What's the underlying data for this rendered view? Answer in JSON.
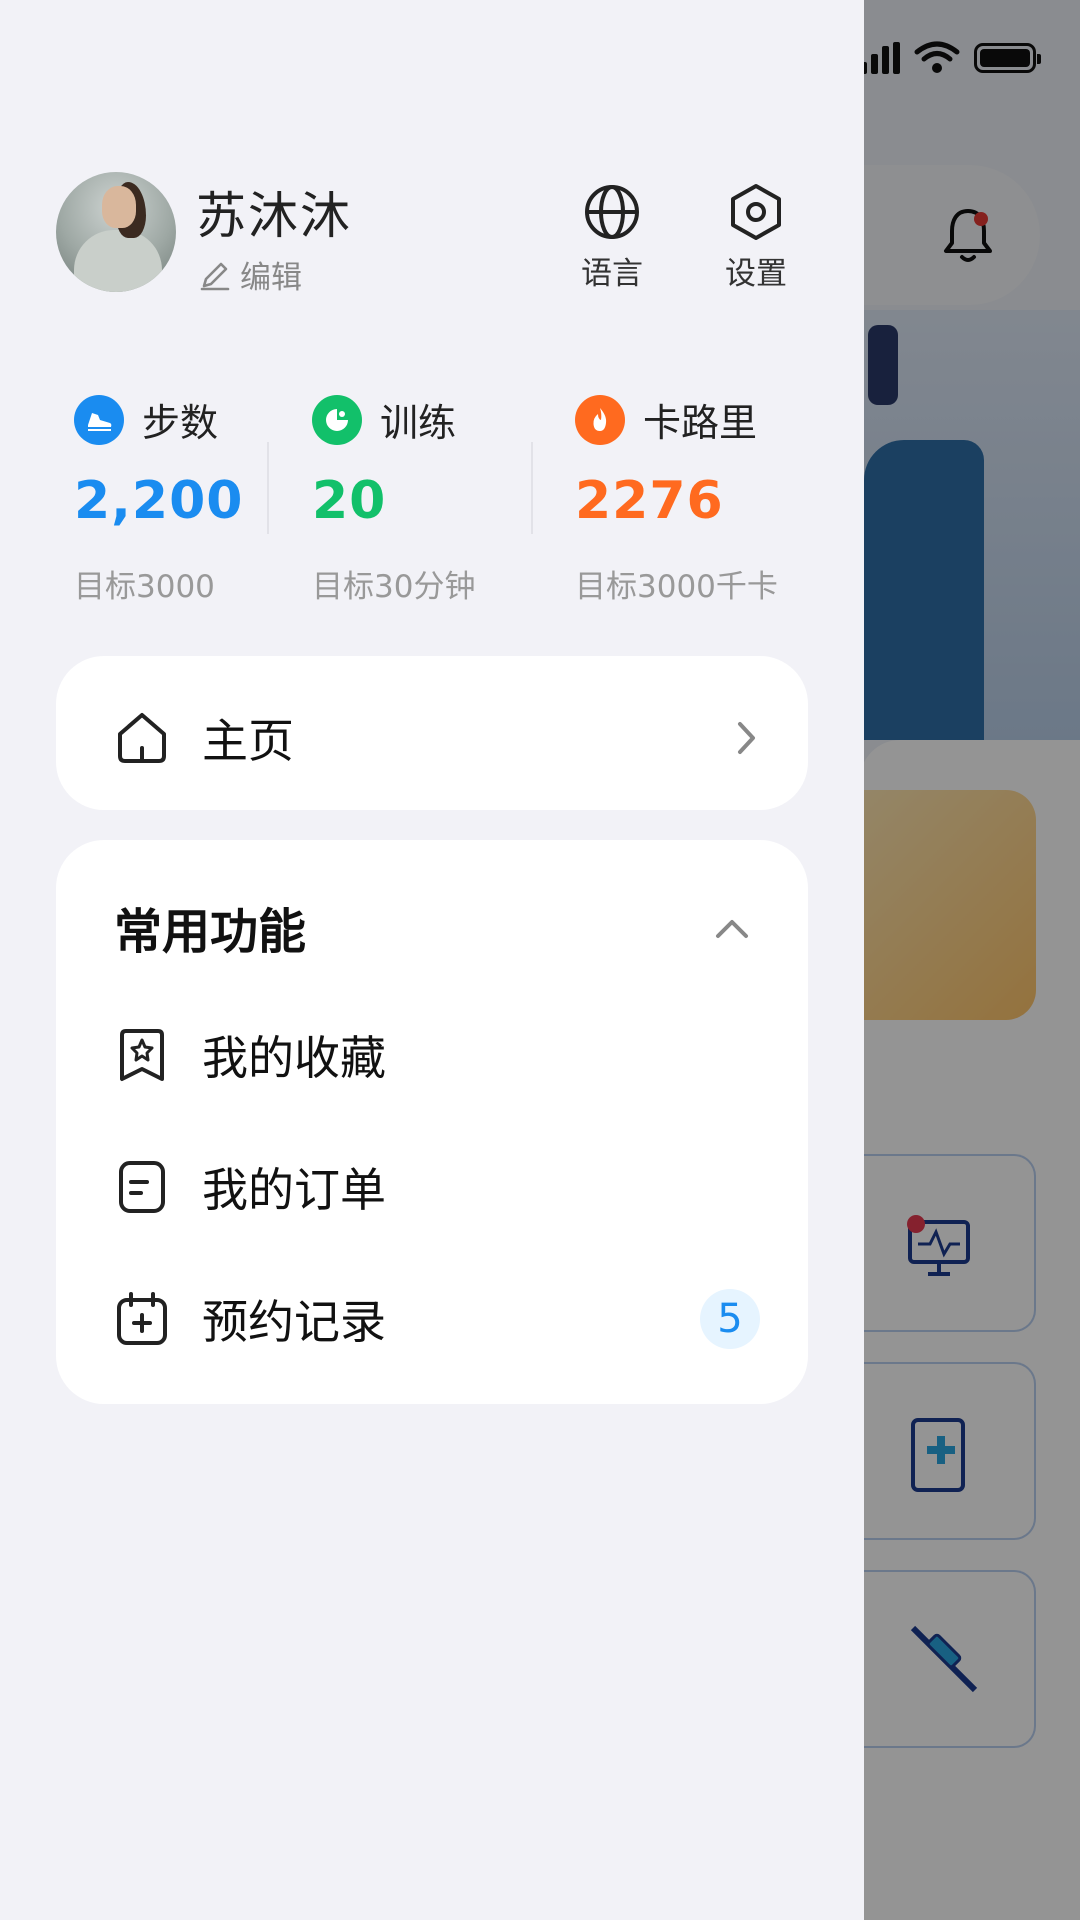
{
  "user": {
    "name": "苏沐沐",
    "edit_label": "编辑"
  },
  "actions": {
    "language_label": "语言",
    "settings_label": "设置"
  },
  "stats": [
    {
      "label": "步数",
      "value": "2,200",
      "goal": "目标3000",
      "color": "#1a8cf0",
      "icon": "sneaker-icon"
    },
    {
      "label": "训练",
      "value": "20",
      "goal": "目标30分钟",
      "color": "#12c06a",
      "icon": "training-icon"
    },
    {
      "label": "卡路里",
      "value": "2276",
      "goal": "目标3000千卡",
      "color": "#ff6a1f",
      "icon": "flame-icon"
    }
  ],
  "menu": {
    "home_label": "主页"
  },
  "functions": {
    "title": "常用功能",
    "items": [
      {
        "label": "我的收藏",
        "icon": "favorites-icon"
      },
      {
        "label": "我的订单",
        "icon": "orders-icon"
      },
      {
        "label": "预约记录",
        "icon": "appointment-icon",
        "badge": "5"
      }
    ]
  },
  "colors": {
    "accent": "#1a8cf0",
    "drawer_bg": "#f2f2f7"
  }
}
